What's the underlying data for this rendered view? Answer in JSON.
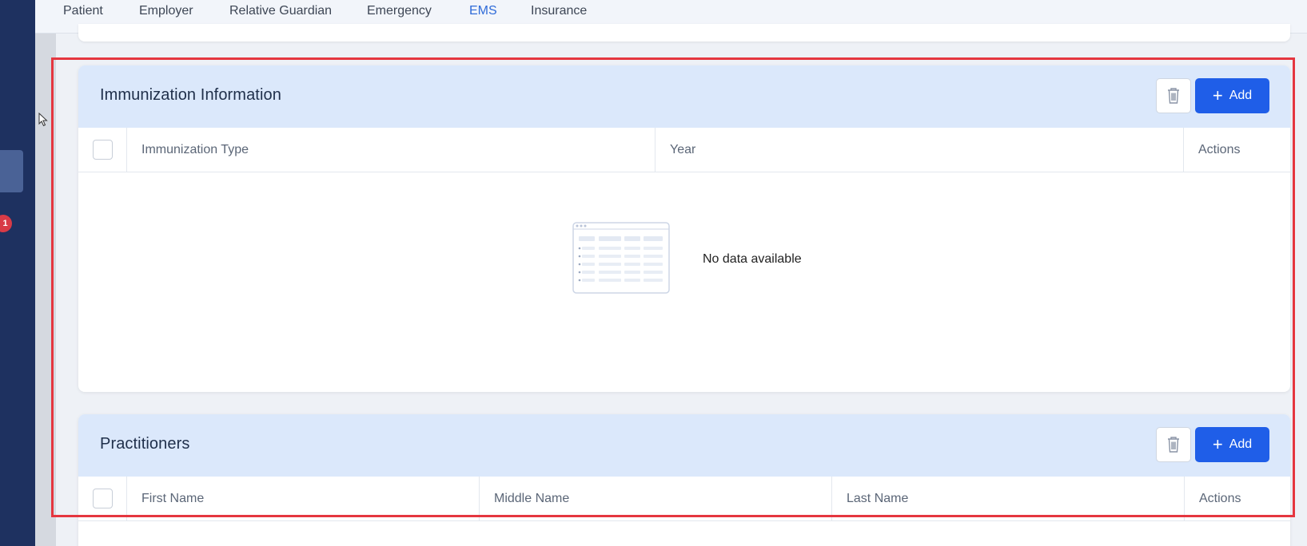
{
  "tabs": [
    {
      "label": "Patient",
      "active": false
    },
    {
      "label": "Employer",
      "active": false
    },
    {
      "label": "Relative Guardian",
      "active": false
    },
    {
      "label": "Emergency",
      "active": false
    },
    {
      "label": "EMS",
      "active": true
    },
    {
      "label": "Insurance",
      "active": false
    }
  ],
  "sidebar": {
    "badge_count": "1"
  },
  "immunization": {
    "title": "Immunization Information",
    "add_label": "Add",
    "columns": [
      "Immunization Type",
      "Year",
      "Actions"
    ],
    "empty_text": "No data available"
  },
  "practitioners": {
    "title": "Practitioners",
    "add_label": "Add",
    "columns": [
      "First Name",
      "Middle Name",
      "Last Name",
      "Actions"
    ]
  },
  "colors": {
    "accent": "#1f5ee8",
    "sidebar": "#1e3160",
    "card_header": "#dbe8fb",
    "highlight": "#e5363f",
    "badge": "#d83b47"
  },
  "icons": [
    "trash-icon",
    "plus-icon",
    "empty-table-icon",
    "mouse-cursor-icon"
  ]
}
